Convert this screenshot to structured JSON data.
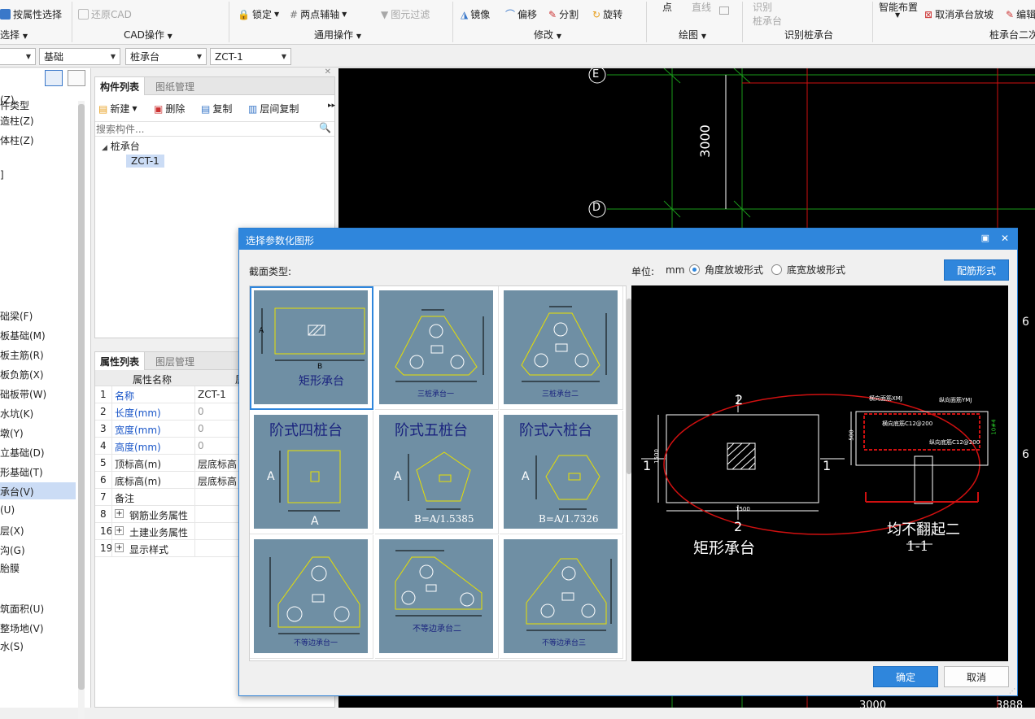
{
  "ribbon": {
    "attr_select": "按属性选择",
    "restore_cad": "还原CAD",
    "lock": "锁定",
    "two_point_axis": "两点辅轴",
    "element_filter": "图元过滤",
    "mirror": "镜像",
    "offset": "偏移",
    "split": "分割",
    "rotate": "旋转",
    "point": "点",
    "line": "直线",
    "identify_line1": "识别",
    "identify_line2": "桩承台",
    "smart_layout": "智能布置",
    "cancel_slope": "取消承台放坡",
    "edit": "编辑",
    "groups": {
      "select": "选择",
      "cad_ops": "CAD操作",
      "common_ops": "通用操作",
      "modify": "修改",
      "draw": "绘图",
      "identify": "识别桩承台",
      "secondary": "桩承台二次"
    }
  },
  "combos": {
    "c0": "",
    "c1": "基础",
    "c2": "桩承台",
    "c3": "ZCT-1"
  },
  "leftnav": {
    "header": "件类型",
    "items": [
      "(Z)",
      "造柱(Z)",
      "体柱(Z)",
      "]",
      "础梁(F)",
      "板基础(M)",
      "板主筋(R)",
      "板负筋(X)",
      "础板带(W)",
      "水坑(K)",
      "墩(Y)",
      "立基础(D)",
      "形基础(T)",
      "承台(V)",
      "(U)",
      "层(X)",
      "沟(G)",
      "胎膜",
      "筑面积(U)",
      "整场地(V)",
      "水(S)"
    ]
  },
  "component_panel": {
    "tab_active": "构件列表",
    "tab_other": "图纸管理",
    "new": "新建",
    "delete": "删除",
    "copy": "复制",
    "floor_copy": "层间复制",
    "search_placeholder": "搜索构件...",
    "tree_root": "桩承台",
    "tree_child": "ZCT-1"
  },
  "property_panel": {
    "tab_active": "属性列表",
    "tab_other": "图层管理",
    "col_name": "属性名称",
    "col_value": "属",
    "rows": [
      {
        "no": "1",
        "name": "名称",
        "value": "ZCT-1",
        "blue": true
      },
      {
        "no": "2",
        "name": "长度(mm)",
        "value": "0",
        "blue": true
      },
      {
        "no": "3",
        "name": "宽度(mm)",
        "value": "0",
        "blue": true
      },
      {
        "no": "4",
        "name": "高度(mm)",
        "value": "0",
        "blue": true
      },
      {
        "no": "5",
        "name": "顶标高(m)",
        "value": "层底标高",
        "blue": false
      },
      {
        "no": "6",
        "name": "底标高(m)",
        "value": "层底标高",
        "blue": false
      },
      {
        "no": "7",
        "name": "备注",
        "value": "",
        "blue": false
      },
      {
        "no": "8",
        "name": "钢筋业务属性",
        "value": "",
        "blue": false,
        "expand": true
      },
      {
        "no": "16",
        "name": "土建业务属性",
        "value": "",
        "blue": false,
        "expand": true
      },
      {
        "no": "19",
        "name": "显示样式",
        "value": "",
        "blue": false,
        "expand": true
      }
    ]
  },
  "cad": {
    "axis_e": "E",
    "axis_d": "D",
    "dim_3000": "3000",
    "right_6a": "6",
    "right_6b": "6",
    "bottom_3000": "3000",
    "bottom_3888": "3888"
  },
  "dialog": {
    "title": "选择参数化图形",
    "section_type": "截面类型:",
    "unit_label": "单位:",
    "unit_value": "mm",
    "radio_angle": "角度放坡形式",
    "radio_width": "底宽放坡形式",
    "rebar_form": "配筋形式",
    "ok": "确定",
    "cancel": "取消",
    "shapes": [
      {
        "label": "矩形承台"
      },
      {
        "label": "三桩承台一"
      },
      {
        "label": "三桩承台二"
      },
      {
        "label": "阶式四桩台",
        "formula": ""
      },
      {
        "label": "阶式五桩台",
        "formula": "B=A/1.5385"
      },
      {
        "label": "阶式六桩台",
        "formula": "B=A/1.7326"
      },
      {
        "label": "不等边承台一"
      },
      {
        "label": "不等边承台二"
      },
      {
        "label": "不等边承台三"
      }
    ],
    "preview": {
      "caption": "矩形承台",
      "section_caption": "均不翻起二",
      "section_id": "1-1",
      "mark_1": "1",
      "mark_2": "2",
      "dim_1500": "1500",
      "dim_500": "500",
      "top_rebar_h": "横向面筋XMJ",
      "top_rebar_v": "纵向面筋YMJ",
      "bottom_rebar_h": "横向底筋C12@200",
      "bottom_rebar_v": "纵向底筋C12@200",
      "side_rebar": "10#4"
    }
  }
}
